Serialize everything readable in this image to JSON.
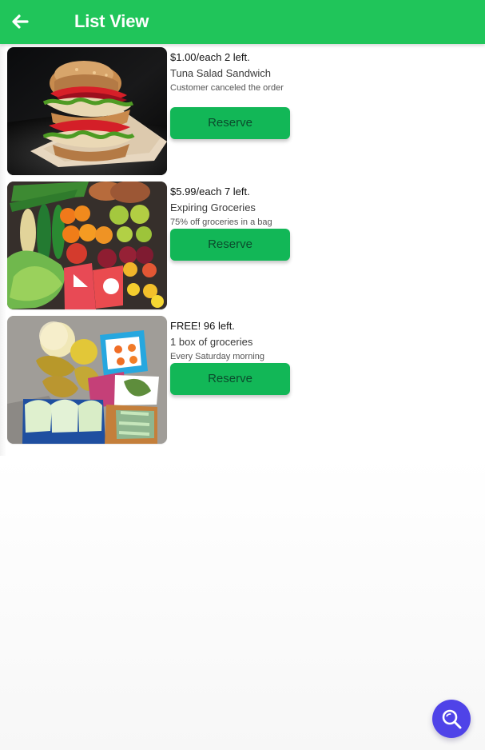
{
  "app_bar": {
    "title": "List View",
    "back_icon": "back-arrow-icon",
    "color": "#20c55a"
  },
  "items": [
    {
      "price_line": "$1.00/each  2 left.",
      "name": "Tuna Salad Sandwich",
      "description": "Customer canceled the order",
      "button_label": "Reserve",
      "image_subject": "sandwich"
    },
    {
      "price_line": "$5.99/each  7 left.",
      "name": "Expiring Groceries",
      "description": "75% off groceries in a bag",
      "button_label": "Reserve",
      "image_subject": "produce-assortment"
    },
    {
      "price_line": "FREE! 96 left.",
      "name": "1 box of groceries",
      "description": "Every Saturday morning",
      "button_label": "Reserve",
      "image_subject": "grocery-box"
    }
  ],
  "search_fab": {
    "icon": "search-icon",
    "color": "#4f43e8"
  },
  "colors": {
    "accent_green": "#20c55a",
    "button_green": "#12b757",
    "button_text": "#0b4b2d"
  }
}
